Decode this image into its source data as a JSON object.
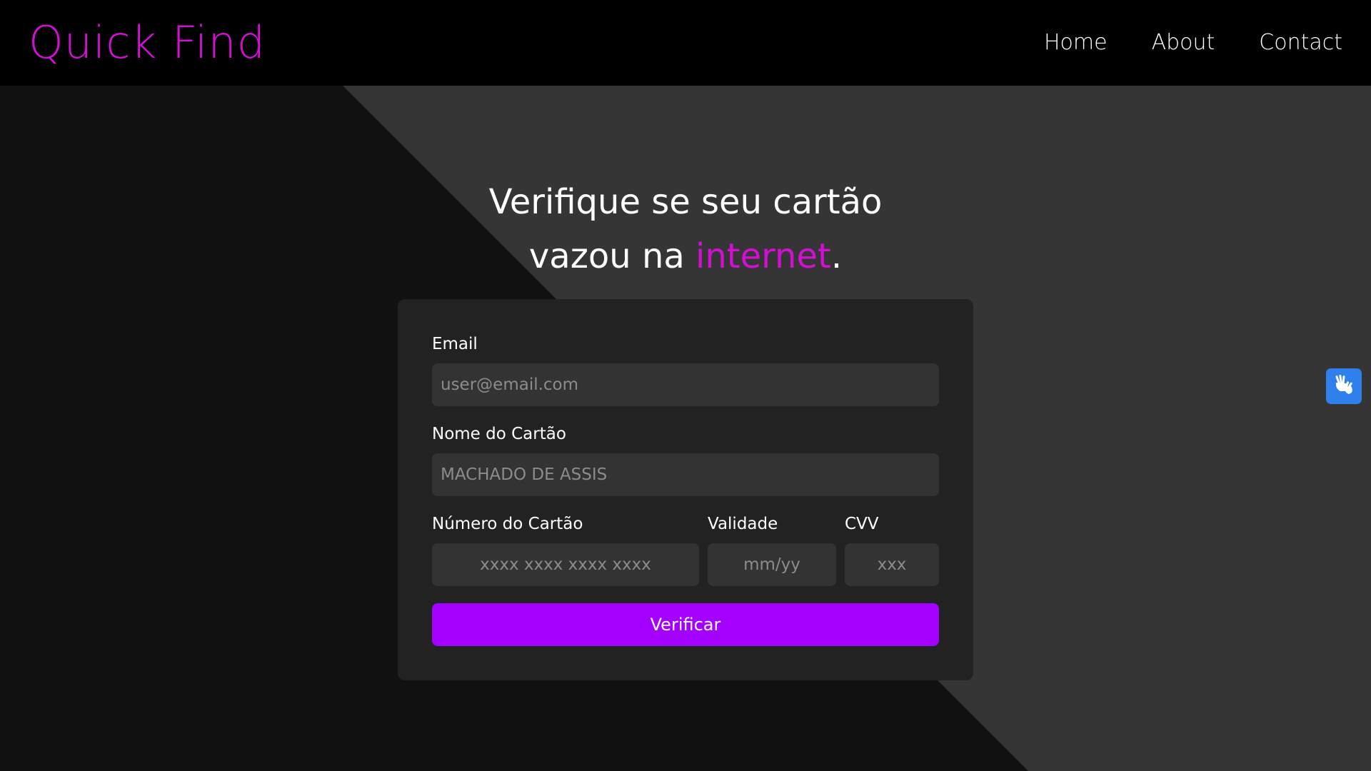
{
  "navbar": {
    "logo": "Quick Find",
    "links": [
      {
        "label": "Home"
      },
      {
        "label": "About"
      },
      {
        "label": "Contact"
      }
    ]
  },
  "hero": {
    "line1": "Verifique se seu cartão",
    "line2_prefix": "vazou na ",
    "line2_accent": "internet",
    "line2_suffix": "."
  },
  "form": {
    "email": {
      "label": "Email",
      "placeholder": "user@email.com",
      "value": ""
    },
    "card_name": {
      "label": "Nome do Cartão",
      "placeholder": "MACHADO DE ASSIS",
      "value": ""
    },
    "card_number": {
      "label": "Número do Cartão",
      "placeholder": "xxxx xxxx xxxx xxxx",
      "value": ""
    },
    "expiry": {
      "label": "Validade",
      "placeholder": "mm/yy",
      "value": ""
    },
    "cvv": {
      "label": "CVV",
      "placeholder": "xxx",
      "value": ""
    },
    "submit_label": "Verificar"
  },
  "accessibility_widget": {
    "icon": "sign-language-hands-icon"
  },
  "colors": {
    "nav_background": "#000000",
    "page_dark": "#111111",
    "page_light": "#353535",
    "card_background": "#222222",
    "input_background": "#333333",
    "accent_magenta": "#d40fd4",
    "button_purple": "#a300ff",
    "widget_blue": "#2f80ed"
  }
}
